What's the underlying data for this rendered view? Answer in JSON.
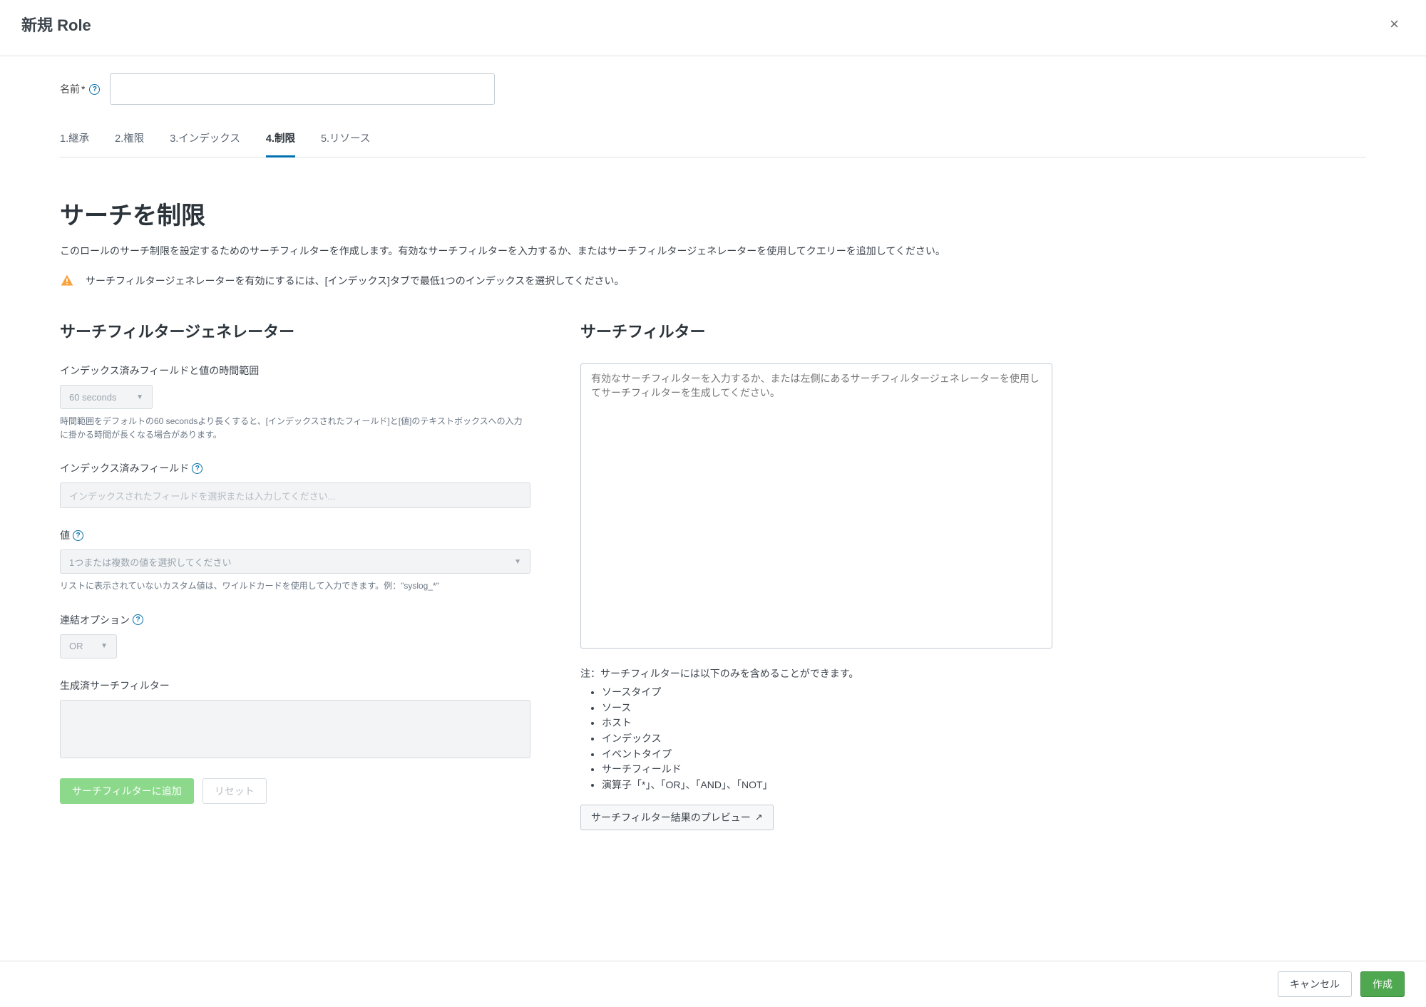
{
  "header": {
    "title": "新規 Role",
    "close_label": "×"
  },
  "name_field": {
    "label": "名前",
    "required_mark": "*",
    "value": ""
  },
  "tabs": [
    {
      "label": "1.継承"
    },
    {
      "label": "2.権限"
    },
    {
      "label": "3.インデックス"
    },
    {
      "label": "4.制限",
      "active": true
    },
    {
      "label": "5.リソース"
    }
  ],
  "page": {
    "heading": "サーチを制限",
    "description": "このロールのサーチ制限を設定するためのサーチフィルターを作成します。有効なサーチフィルターを入力するか、またはサーチフィルタージェネレーターを使用してクエリーを追加してください。",
    "warning": "サーチフィルタージェネレーターを有効にするには、[インデックス]タブで最低1つのインデックスを選択してください。"
  },
  "generator": {
    "heading": "サーチフィルタージェネレーター",
    "time_label": "インデックス済みフィールドと値の時間範囲",
    "time_value": "60 seconds",
    "time_hint": "時間範囲をデフォルトの60 secondsより長くすると、[インデックスされたフィールド]と[値]のテキストボックスへの入力に掛かる時間が長くなる場合があります。",
    "field_label": "インデックス済みフィールド",
    "field_placeholder": "インデックスされたフィールドを選択または入力してください...",
    "value_label": "値",
    "value_placeholder": "1つまたは複数の値を選択してください",
    "value_hint": "リストに表示されていないカスタム値は、ワイルドカードを使用して入力できます。例：\"syslog_*\"",
    "concat_label": "連結オプション",
    "concat_value": "OR",
    "generated_label": "生成済サーチフィルター",
    "add_button": "サーチフィルターに追加",
    "reset_button": "リセット"
  },
  "filter": {
    "heading": "サーチフィルター",
    "placeholder": "有効なサーチフィルターを入力するか、または左側にあるサーチフィルタージェネレーターを使用してサーチフィルターを生成してください。",
    "value": "",
    "note_label": "注：サーチフィルターには以下のみを含めることができます。",
    "note_items": [
      "ソースタイプ",
      "ソース",
      "ホスト",
      "インデックス",
      "イベントタイプ",
      "サーチフィールド",
      "演算子「*」、「OR」、「AND」、「NOT」"
    ],
    "preview_button": "サーチフィルター結果のプレビュー"
  },
  "footer": {
    "cancel": "キャンセル",
    "create": "作成"
  }
}
